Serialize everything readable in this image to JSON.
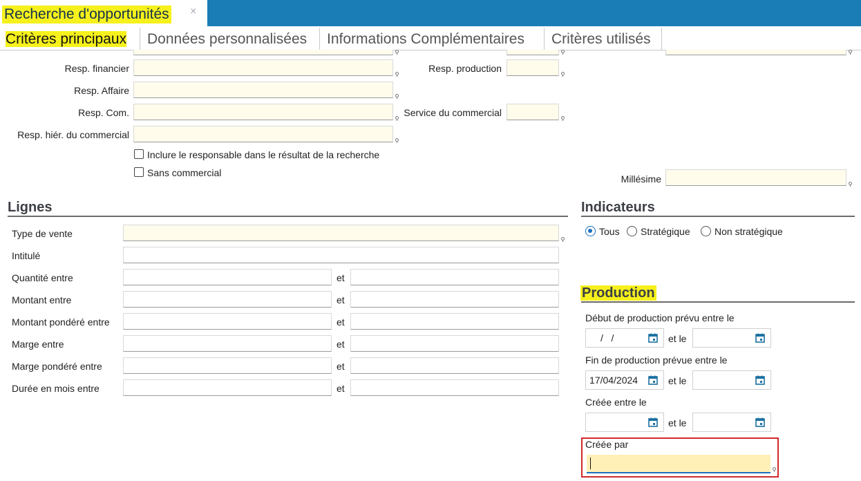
{
  "window": {
    "doc_tab_title": "Recherche d'opportunités",
    "close_glyph": "×"
  },
  "tabs": [
    {
      "label": "Critères principaux"
    },
    {
      "label": "Données personnalisées"
    },
    {
      "label": "Informations Complémentaires"
    },
    {
      "label": "Critères utilisés"
    }
  ],
  "responsables": {
    "resp_financier": "Resp. financier",
    "resp_affaire": "Resp. Affaire",
    "resp_com": "Resp. Com.",
    "resp_hier": "Resp. hiér. du commercial",
    "resp_production": "Resp. production",
    "service_commercial": "Service du commercial",
    "inclure_responsable": "Inclure le responsable dans le résultat de la recherche",
    "sans_commercial": "Sans commercial",
    "millesime": "Millésime"
  },
  "lignes": {
    "title": "Lignes",
    "type_vente": "Type de vente",
    "intitule": "Intitulé",
    "quantite": "Quantité entre",
    "montant": "Montant entre",
    "montant_pondere": "Montant pondéré entre",
    "marge": "Marge entre",
    "marge_ponderee": "Marge pondéré entre",
    "duree": "Durée en mois entre",
    "et": "et"
  },
  "indicateurs": {
    "title": "Indicateurs",
    "options": [
      "Tous",
      "Stratégique",
      "Non stratégique"
    ],
    "selected": "Tous"
  },
  "production": {
    "title": "Production",
    "debut_label": "Début de production prévu entre le",
    "debut_from": "/   /",
    "fin_label": "Fin de production prévue entre le",
    "fin_from": "17/04/2024",
    "creee_label": "Créée entre le",
    "et_le": "et le",
    "creee_par_label": "Créée par"
  },
  "colors": {
    "accent": "#1a7db5",
    "highlight": "#f6f11c",
    "field_bg": "#fffcec",
    "focus_border": "#d12a2a"
  }
}
